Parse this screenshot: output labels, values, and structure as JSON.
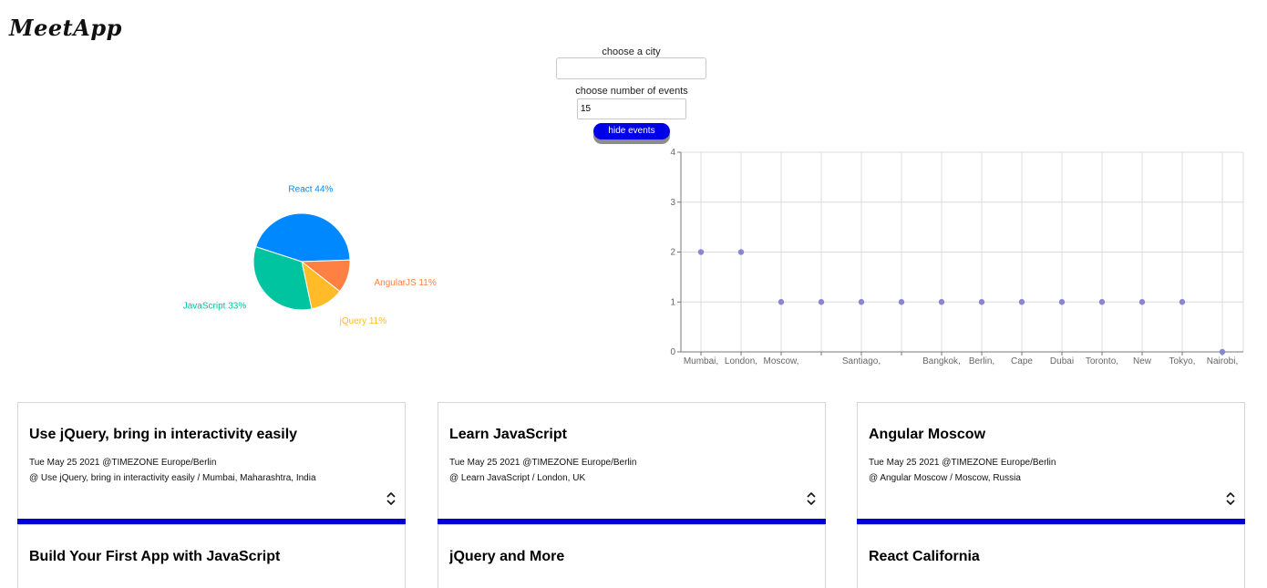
{
  "app": {
    "title": "MeetApp"
  },
  "controls": {
    "city_label": "choose a city",
    "city_value": "",
    "number_label": "choose number of events",
    "number_value": "15",
    "toggle_label": "hide events"
  },
  "colors": {
    "accent": "#0000e8",
    "react": "#0088fe",
    "javascript": "#00c49f",
    "jquery": "#ffbb28",
    "angularjs": "#ff8042",
    "scatter_point": "#8884d8"
  },
  "chart_data": [
    {
      "type": "pie",
      "slices": [
        {
          "name": "React",
          "value": 44,
          "label": "React 44%",
          "color": "#0088fe"
        },
        {
          "name": "AngularJS",
          "value": 11,
          "label": "AngularJS 11%",
          "color": "#ff8042"
        },
        {
          "name": "jQuery",
          "value": 11,
          "label": "jQuery 11%",
          "color": "#ffbb28"
        },
        {
          "name": "JavaScript",
          "value": 33,
          "label": "JavaScript 33%",
          "color": "#00c49f"
        }
      ]
    },
    {
      "type": "scatter",
      "grid": true,
      "ylim": [
        0,
        4
      ],
      "yticks": [
        "0",
        "1",
        "2",
        "3",
        "4"
      ],
      "categories": [
        "Mumbai,",
        "London,",
        "Moscow,",
        "",
        "Santiago,",
        "",
        "Bangkok,",
        "Berlin,",
        "Cape",
        "Dubai",
        "Toronto,",
        "New",
        "Tokyo,",
        "Nairobi,"
      ],
      "values": [
        2,
        2,
        1,
        1,
        1,
        1,
        1,
        1,
        1,
        1,
        1,
        1,
        1,
        0
      ]
    }
  ],
  "events": [
    {
      "title": "Use jQuery, bring in interactivity easily",
      "date": "Tue May 25 2021 @TIMEZONE Europe/Berlin",
      "location": "@ Use jQuery, bring in interactivity easily / Mumbai, Maharashtra, India"
    },
    {
      "title": "Learn JavaScript",
      "date": "Tue May 25 2021 @TIMEZONE Europe/Berlin",
      "location": "@ Learn JavaScript / London, UK"
    },
    {
      "title": "Angular Moscow",
      "date": "Tue May 25 2021 @TIMEZONE Europe/Berlin",
      "location": "@ Angular Moscow / Moscow, Russia"
    },
    {
      "title": "Build Your First App with JavaScript"
    },
    {
      "title": "jQuery and More"
    },
    {
      "title": "React California"
    }
  ]
}
